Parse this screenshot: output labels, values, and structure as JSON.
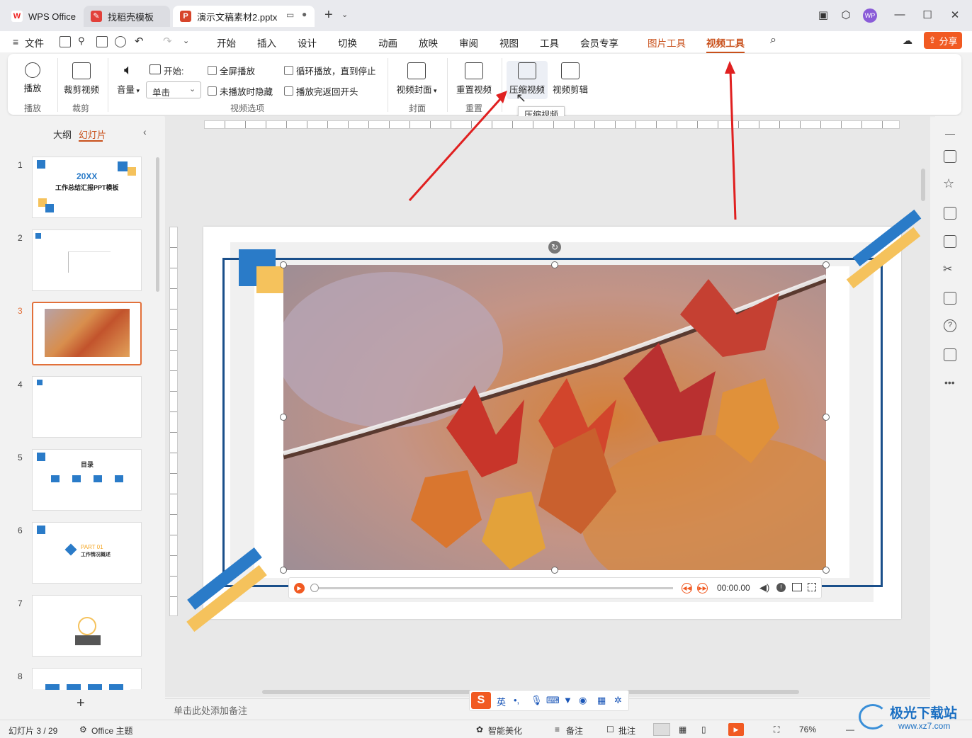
{
  "tabs": [
    {
      "label": "WPS Office",
      "icon": "wps-logo-icon"
    },
    {
      "label": "找稻壳模板",
      "icon": "docer-icon"
    },
    {
      "label": "演示文稿素材2.pptx",
      "icon": "ppt-file-icon"
    }
  ],
  "menu": {
    "file": "文件",
    "items": [
      "开始",
      "插入",
      "设计",
      "切换",
      "动画",
      "放映",
      "审阅",
      "视图",
      "工具",
      "会员专享"
    ],
    "picture_tools": "图片工具",
    "video_tools": "视频工具",
    "share": "分享"
  },
  "ribbon": {
    "play": "播放",
    "play_group": "播放",
    "crop_video": "裁剪视频",
    "crop_group": "裁剪",
    "volume": "音量",
    "start_label": "开始:",
    "start_value": "单击",
    "fullscreen": "全屏播放",
    "hide_when_not_playing": "未播放时隐藏",
    "loop": "循环播放，直到停止",
    "rewind": "播放完返回开头",
    "options_group": "视频选项",
    "cover": "视频封面",
    "cover_group": "封面",
    "reset": "重置视频",
    "reset_group": "重置",
    "compress": "压缩视频",
    "edit": "视频剪辑",
    "tooltip": "压缩视频"
  },
  "sidebar": {
    "outline": "大纲",
    "slides": "幻灯片",
    "numbers": [
      "1",
      "2",
      "3",
      "4",
      "5",
      "6",
      "7",
      "8"
    ],
    "slide1_title": "20XX",
    "slide1_subtitle": "工作总结汇报PPT模板",
    "slide5_title": "目录",
    "slide6_part": "PART 01",
    "slide6_title": "工作情况概述"
  },
  "video": {
    "time": "00:00.00"
  },
  "notes_placeholder": "单击此处添加备注",
  "ime": {
    "lang": "英"
  },
  "status": {
    "slide_info": "幻灯片 3 / 29",
    "theme": "Office 主题",
    "beautify": "智能美化",
    "notes": "备注",
    "comments": "批注",
    "zoom": "76%"
  },
  "watermark": {
    "text": "极光下载站",
    "url": "www.xz7.com"
  },
  "colors": {
    "accent": "#c9511c",
    "share": "#f15a22",
    "slide_blue": "#1a4f8a",
    "slide_yellow": "#f5c25c"
  }
}
